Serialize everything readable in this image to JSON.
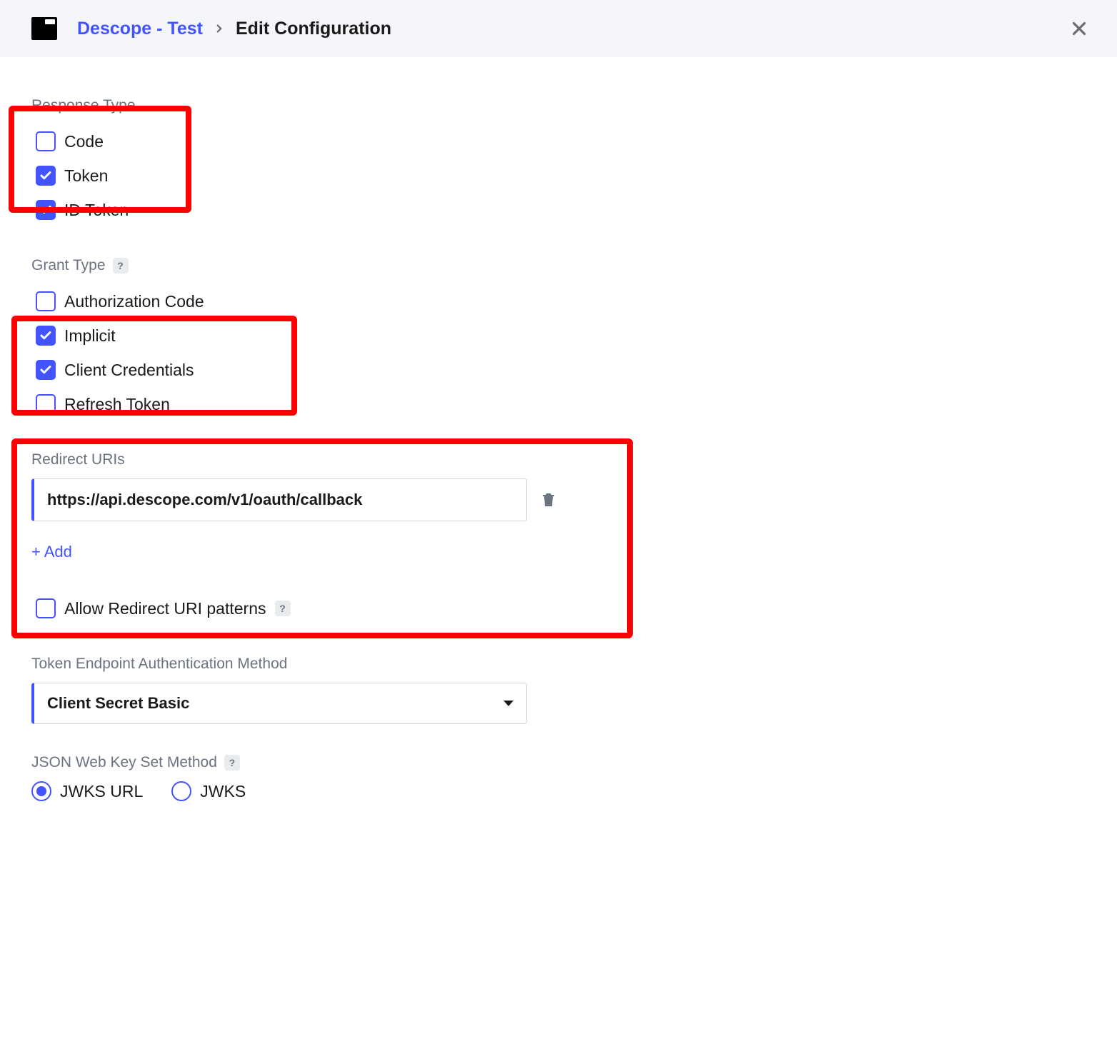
{
  "header": {
    "breadcrumb_link": "Descope - Test",
    "breadcrumb_current": "Edit Configuration"
  },
  "responseType": {
    "label": "Response Type",
    "options": [
      {
        "label": "Code",
        "checked": false
      },
      {
        "label": "Token",
        "checked": true
      },
      {
        "label": "ID Token",
        "checked": true
      }
    ]
  },
  "grantType": {
    "label": "Grant Type",
    "options": [
      {
        "label": "Authorization Code",
        "checked": false
      },
      {
        "label": "Implicit",
        "checked": true
      },
      {
        "label": "Client Credentials",
        "checked": true
      },
      {
        "label": "Refresh Token",
        "checked": false
      }
    ]
  },
  "redirect": {
    "label": "Redirect URIs",
    "value": "https://api.descope.com/v1/oauth/callback",
    "add": "+ Add"
  },
  "allowPatterns": {
    "label": "Allow Redirect URI patterns",
    "checked": false
  },
  "tokenAuth": {
    "label": "Token Endpoint Authentication Method",
    "value": "Client Secret Basic"
  },
  "jwks": {
    "label": "JSON Web Key Set Method",
    "options": [
      {
        "label": "JWKS URL",
        "selected": true
      },
      {
        "label": "JWKS",
        "selected": false
      }
    ]
  }
}
